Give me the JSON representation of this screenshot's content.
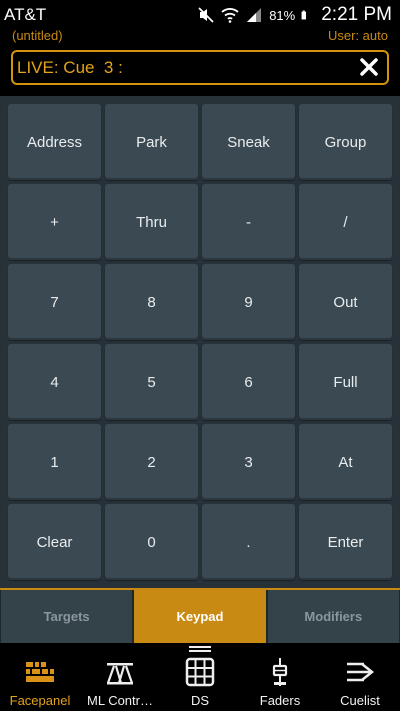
{
  "status_bar": {
    "carrier": "AT&T",
    "battery": "81%",
    "time": "2:21 PM"
  },
  "header": {
    "file_name": "(untitled)",
    "user": "User: auto",
    "command_line": "LIVE: Cue  3 :"
  },
  "colors": {
    "accent": "#c98a13",
    "keypad_bg": "#273238",
    "key_bg": "#3b4a52"
  },
  "keypad": {
    "rows": [
      [
        "Address",
        "Park",
        "Sneak",
        "Group"
      ],
      [
        "+",
        "Thru",
        "-",
        "/"
      ],
      [
        "7",
        "8",
        "9",
        "Out"
      ],
      [
        "4",
        "5",
        "6",
        "Full"
      ],
      [
        "1",
        "2",
        "3",
        "At"
      ],
      [
        "Clear",
        "0",
        ".",
        "Enter"
      ]
    ]
  },
  "mode_tabs": {
    "targets": "Targets",
    "keypad": "Keypad",
    "modifiers": "Modifiers",
    "active": "Keypad"
  },
  "bottom_nav": {
    "items": [
      {
        "label": "Facepanel",
        "icon": "facepanel-icon",
        "active": true
      },
      {
        "label": "ML Contr…",
        "icon": "moving-light-icon"
      },
      {
        "label": "DS",
        "icon": "direct-select-grid-icon"
      },
      {
        "label": "Faders",
        "icon": "fader-icon"
      },
      {
        "label": "Cuelist",
        "icon": "cuelist-icon"
      }
    ]
  }
}
